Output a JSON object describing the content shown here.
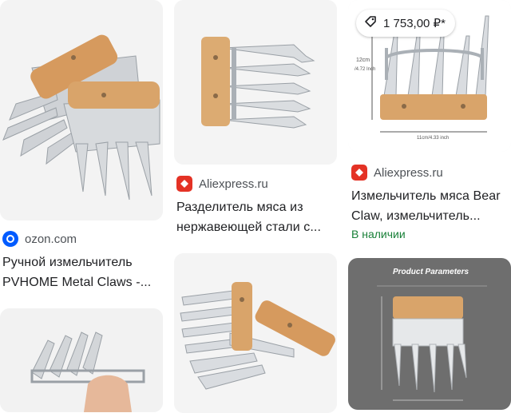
{
  "results": [
    {
      "column": 0,
      "source": "ozon.com",
      "favicon": "ozon-logo-icon",
      "title_lines": [
        "Ручной измельчитель",
        "PVHOME Metal Claws -..."
      ]
    },
    {
      "column": 1,
      "source": "Aliexpress.ru",
      "favicon": "aliexpress-logo-icon",
      "title_lines": [
        "Разделитель мяса из",
        "нержавеющей стали с..."
      ]
    },
    {
      "column": 2,
      "source": "Aliexpress.ru",
      "favicon": "aliexpress-logo-icon",
      "price": "1 753,00 ₽*",
      "title_lines": [
        "Измельчитель мяса Bear",
        "Claw, измельчитель..."
      ],
      "availability": "В наличии",
      "image_labels": {
        "height_cm": "12cm",
        "height_inch": "/4.72 Inch",
        "width": "11cm/4.33 inch"
      }
    },
    {
      "column": 2,
      "image_labels": {
        "heading": "Product Parameters"
      }
    }
  ],
  "colors": {
    "ozon": "#005bff",
    "aliexpress": "#e43225",
    "in_stock": "#188038",
    "wood": "#d9a46a",
    "steel": "#c9ccd0"
  }
}
